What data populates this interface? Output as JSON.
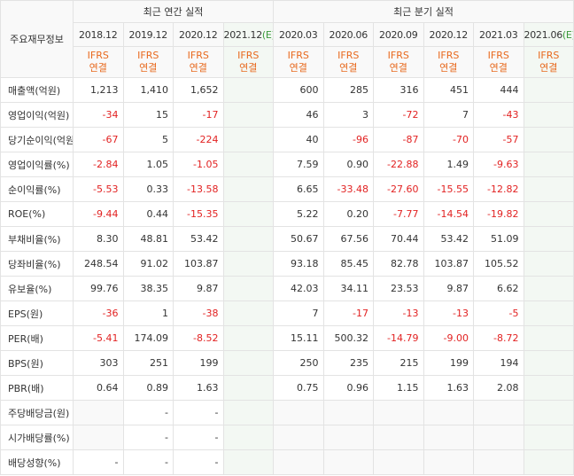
{
  "header": {
    "corner_label": "주요재무정보",
    "annual_group": "최근 연간 실적",
    "quarterly_group": "최근 분기 실적",
    "estimate_mark": "(E)",
    "ifrs_line1": "IFRS",
    "ifrs_line2": "연결",
    "annual_periods": [
      {
        "label": "2018.12",
        "estimate": false
      },
      {
        "label": "2019.12",
        "estimate": false
      },
      {
        "label": "2020.12",
        "estimate": false
      },
      {
        "label": "2021.12",
        "estimate": true
      }
    ],
    "quarter_periods": [
      {
        "label": "2020.03",
        "estimate": false
      },
      {
        "label": "2020.06",
        "estimate": false
      },
      {
        "label": "2020.09",
        "estimate": false
      },
      {
        "label": "2020.12",
        "estimate": false
      },
      {
        "label": "2021.03",
        "estimate": false
      },
      {
        "label": "2021.06",
        "estimate": true
      }
    ]
  },
  "rows": [
    {
      "label": "매출액(억원)",
      "group_start": true,
      "annual": [
        "1,213",
        "1,410",
        "1,652",
        ""
      ],
      "quarter": [
        "600",
        "285",
        "316",
        "451",
        "444",
        ""
      ]
    },
    {
      "label": "영업이익(억원)",
      "group_start": false,
      "annual": [
        "-34",
        "15",
        "-17",
        ""
      ],
      "quarter": [
        "46",
        "3",
        "-72",
        "7",
        "-43",
        ""
      ]
    },
    {
      "label": "당기순이익(억원)",
      "group_start": false,
      "annual": [
        "-67",
        "5",
        "-224",
        ""
      ],
      "quarter": [
        "40",
        "-96",
        "-87",
        "-70",
        "-57",
        ""
      ]
    },
    {
      "label": "영업이익률(%)",
      "group_start": true,
      "annual": [
        "-2.84",
        "1.05",
        "-1.05",
        ""
      ],
      "quarter": [
        "7.59",
        "0.90",
        "-22.88",
        "1.49",
        "-9.63",
        ""
      ]
    },
    {
      "label": "순이익률(%)",
      "group_start": false,
      "annual": [
        "-5.53",
        "0.33",
        "-13.58",
        ""
      ],
      "quarter": [
        "6.65",
        "-33.48",
        "-27.60",
        "-15.55",
        "-12.82",
        ""
      ]
    },
    {
      "label": "ROE(%)",
      "group_start": false,
      "annual": [
        "-9.44",
        "0.44",
        "-15.35",
        ""
      ],
      "quarter": [
        "5.22",
        "0.20",
        "-7.77",
        "-14.54",
        "-19.82",
        ""
      ]
    },
    {
      "label": "부채비율(%)",
      "group_start": true,
      "annual": [
        "8.30",
        "48.81",
        "53.42",
        ""
      ],
      "quarter": [
        "50.67",
        "67.56",
        "70.44",
        "53.42",
        "51.09",
        ""
      ]
    },
    {
      "label": "당좌비율(%)",
      "group_start": false,
      "annual": [
        "248.54",
        "91.02",
        "103.87",
        ""
      ],
      "quarter": [
        "93.18",
        "85.45",
        "82.78",
        "103.87",
        "105.52",
        ""
      ]
    },
    {
      "label": "유보율(%)",
      "group_start": false,
      "annual": [
        "99.76",
        "38.35",
        "9.87",
        ""
      ],
      "quarter": [
        "42.03",
        "34.11",
        "23.53",
        "9.87",
        "6.62",
        ""
      ]
    },
    {
      "label": "EPS(원)",
      "group_start": true,
      "annual": [
        "-36",
        "1",
        "-38",
        ""
      ],
      "quarter": [
        "7",
        "-17",
        "-13",
        "-13",
        "-5",
        ""
      ]
    },
    {
      "label": "PER(배)",
      "group_start": false,
      "annual": [
        "-5.41",
        "174.09",
        "-8.52",
        ""
      ],
      "quarter": [
        "15.11",
        "500.32",
        "-14.79",
        "-9.00",
        "-8.72",
        ""
      ]
    },
    {
      "label": "BPS(원)",
      "group_start": false,
      "annual": [
        "303",
        "251",
        "199",
        ""
      ],
      "quarter": [
        "250",
        "235",
        "215",
        "199",
        "194",
        ""
      ]
    },
    {
      "label": "PBR(배)",
      "group_start": false,
      "annual": [
        "0.64",
        "0.89",
        "1.63",
        ""
      ],
      "quarter": [
        "0.75",
        "0.96",
        "1.15",
        "1.63",
        "2.08",
        ""
      ]
    },
    {
      "label": "주당배당금(원)",
      "group_start": true,
      "annual": [
        null,
        "-",
        "-",
        ""
      ],
      "quarter": [
        null,
        null,
        null,
        null,
        null,
        ""
      ]
    },
    {
      "label": "시가배당률(%)",
      "group_start": false,
      "annual": [
        null,
        "-",
        "-",
        ""
      ],
      "quarter": [
        null,
        null,
        null,
        null,
        null,
        ""
      ]
    },
    {
      "label": "배당성향(%)",
      "group_start": false,
      "annual": [
        "-",
        "-",
        "-",
        ""
      ],
      "quarter": [
        null,
        null,
        null,
        null,
        null,
        ""
      ]
    }
  ]
}
